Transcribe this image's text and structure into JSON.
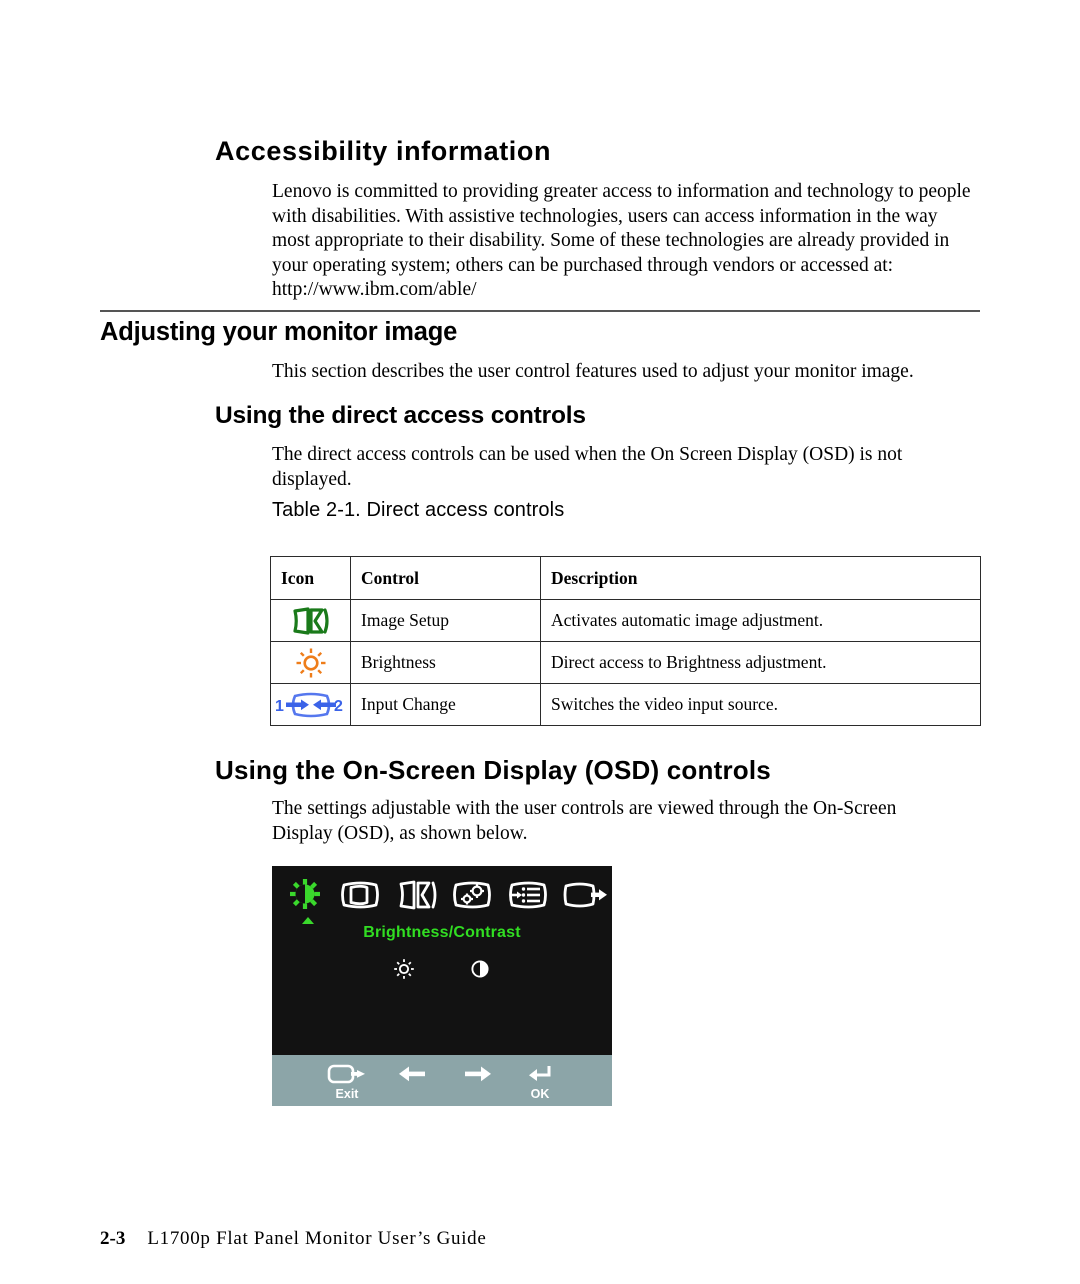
{
  "sections": {
    "accessibility": {
      "heading": "Accessibility information",
      "body": "Lenovo is committed to providing greater access to information and technology to people with disabilities. With assistive technologies, users can access information in the way most appropriate to their disability. Some of these technologies are already provided in your operating system; others can be purchased through vendors or accessed at: http://www.ibm.com/able/"
    },
    "adjusting": {
      "heading": "Adjusting your monitor image",
      "body": "This section describes the user control features used to adjust your monitor image."
    },
    "direct_access": {
      "heading": "Using the direct access controls",
      "body": "The direct access controls can be used when the On Screen Display (OSD) is not displayed.",
      "table_caption": "Table 2-1. Direct access controls"
    },
    "osd_controls": {
      "heading": "Using the On-Screen Display (OSD) controls",
      "body": "The settings adjustable with the user controls are viewed through the On-Screen Display (OSD), as shown below."
    }
  },
  "table": {
    "headers": [
      "Icon",
      "Control",
      "Description"
    ],
    "rows": [
      {
        "icon_name": "image-setup-icon",
        "icon_color": "#1a7a1a",
        "control": "Image Setup",
        "description": "Activates automatic image adjustment."
      },
      {
        "icon_name": "brightness-sun-icon",
        "icon_color": "#ee7d1a",
        "control": "Brightness",
        "description": "Direct access to Brightness adjustment."
      },
      {
        "icon_name": "input-change-icon",
        "icon_color": "#5577ee",
        "control": "Input Change",
        "description": "Switches the video input source.",
        "label_left": "1",
        "label_right": "2"
      }
    ]
  },
  "osd": {
    "title": "Brightness/Contrast",
    "title_color": "#31dd22",
    "background_color": "#121212",
    "bar_color": "#8ca5a8",
    "menu_icons": [
      {
        "name": "brightness-contrast-menu-icon",
        "selected": true
      },
      {
        "name": "image-position-menu-icon",
        "selected": false
      },
      {
        "name": "image-setup-menu-icon",
        "selected": false
      },
      {
        "name": "image-properties-menu-icon",
        "selected": false
      },
      {
        "name": "options-menu-icon",
        "selected": false
      },
      {
        "name": "exit-menu-icon",
        "selected": false
      }
    ],
    "sub_icons": [
      {
        "name": "brightness-icon"
      },
      {
        "name": "contrast-icon"
      }
    ],
    "buttons": [
      {
        "name": "exit-button",
        "label": "Exit",
        "glyph": "exit-icon"
      },
      {
        "name": "left-arrow-button",
        "label": "",
        "glyph": "arrow-left-icon"
      },
      {
        "name": "right-arrow-button",
        "label": "",
        "glyph": "arrow-right-icon"
      },
      {
        "name": "ok-button",
        "label": "OK",
        "glyph": "enter-icon"
      }
    ]
  },
  "footer": {
    "page_number": "2-3",
    "document_title": "L1700p Flat Panel Monitor User’s Guide"
  }
}
